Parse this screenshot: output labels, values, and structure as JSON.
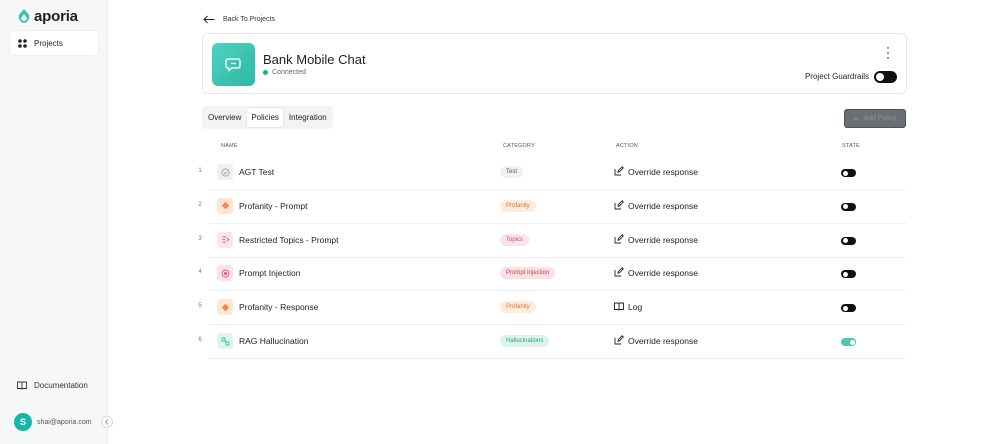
{
  "sidebar": {
    "logo_text": "aporia",
    "projects_label": "Projects",
    "documentation_label": "Documentation",
    "user_initial": "S",
    "user_email": "shai@aporia.com"
  },
  "header": {
    "back_label": "Back To Projects"
  },
  "project": {
    "name": "Bank Mobile Chat",
    "status": "Connected",
    "guardrails_label": "Project Guardrails",
    "guardrails_enabled": true
  },
  "tabs": [
    {
      "label": "Overview",
      "active": false
    },
    {
      "label": "Policies",
      "active": true
    },
    {
      "label": "Integration",
      "active": false
    }
  ],
  "add_button_label": "Add Policy",
  "table": {
    "columns": {
      "name": "NAME",
      "category": "CATEGORY",
      "action": "ACTION",
      "state": "STATE"
    },
    "rows": [
      {
        "num": "1",
        "name": "AGT Test",
        "category": "Test",
        "action": "Override response",
        "action_icon": "edit-icon",
        "icon": "check-circle-icon",
        "color": "#9aa0a8",
        "badge_bg": "#eef0f3",
        "badge_fg": "#555b63",
        "icon_bg": "#eef0f3",
        "enabled": false
      },
      {
        "num": "2",
        "name": "Profanity - Prompt",
        "category": "Profanity",
        "action": "Override response",
        "action_icon": "edit-icon",
        "icon": "alert-icon",
        "color": "#f08a4b",
        "badge_bg": "#fdebdc",
        "badge_fg": "#d9702e",
        "icon_bg": "#fde6d6",
        "enabled": false
      },
      {
        "num": "3",
        "name": "Restricted Topics - Prompt",
        "category": "Topics",
        "action": "Override response",
        "action_icon": "edit-icon",
        "icon": "topics-icon",
        "color": "#e05b8c",
        "badge_bg": "#fbe3ec",
        "badge_fg": "#d04a7c",
        "icon_bg": "#fce4ed",
        "enabled": false
      },
      {
        "num": "4",
        "name": "Prompt Injection",
        "category": "Prompt Injection",
        "action": "Override response",
        "action_icon": "edit-icon",
        "icon": "injection-icon",
        "color": "#e0566a",
        "badge_bg": "#fbe1e3",
        "badge_fg": "#cc4254",
        "icon_bg": "#fce3e6",
        "enabled": false
      },
      {
        "num": "5",
        "name": "Profanity - Response",
        "category": "Profanity",
        "action": "Log",
        "action_icon": "book-icon",
        "icon": "alert-icon",
        "color": "#f08a4b",
        "badge_bg": "#fdebdc",
        "badge_fg": "#d9702e",
        "icon_bg": "#fde6d6",
        "enabled": false
      },
      {
        "num": "6",
        "name": "RAG Hallucination",
        "category": "Hallucinations",
        "action": "Override response",
        "action_icon": "edit-icon",
        "icon": "hallucination-icon",
        "color": "#2fb58a",
        "badge_bg": "#dcf5eb",
        "badge_fg": "#23a076",
        "icon_bg": "#def5ec",
        "enabled": true
      }
    ]
  }
}
